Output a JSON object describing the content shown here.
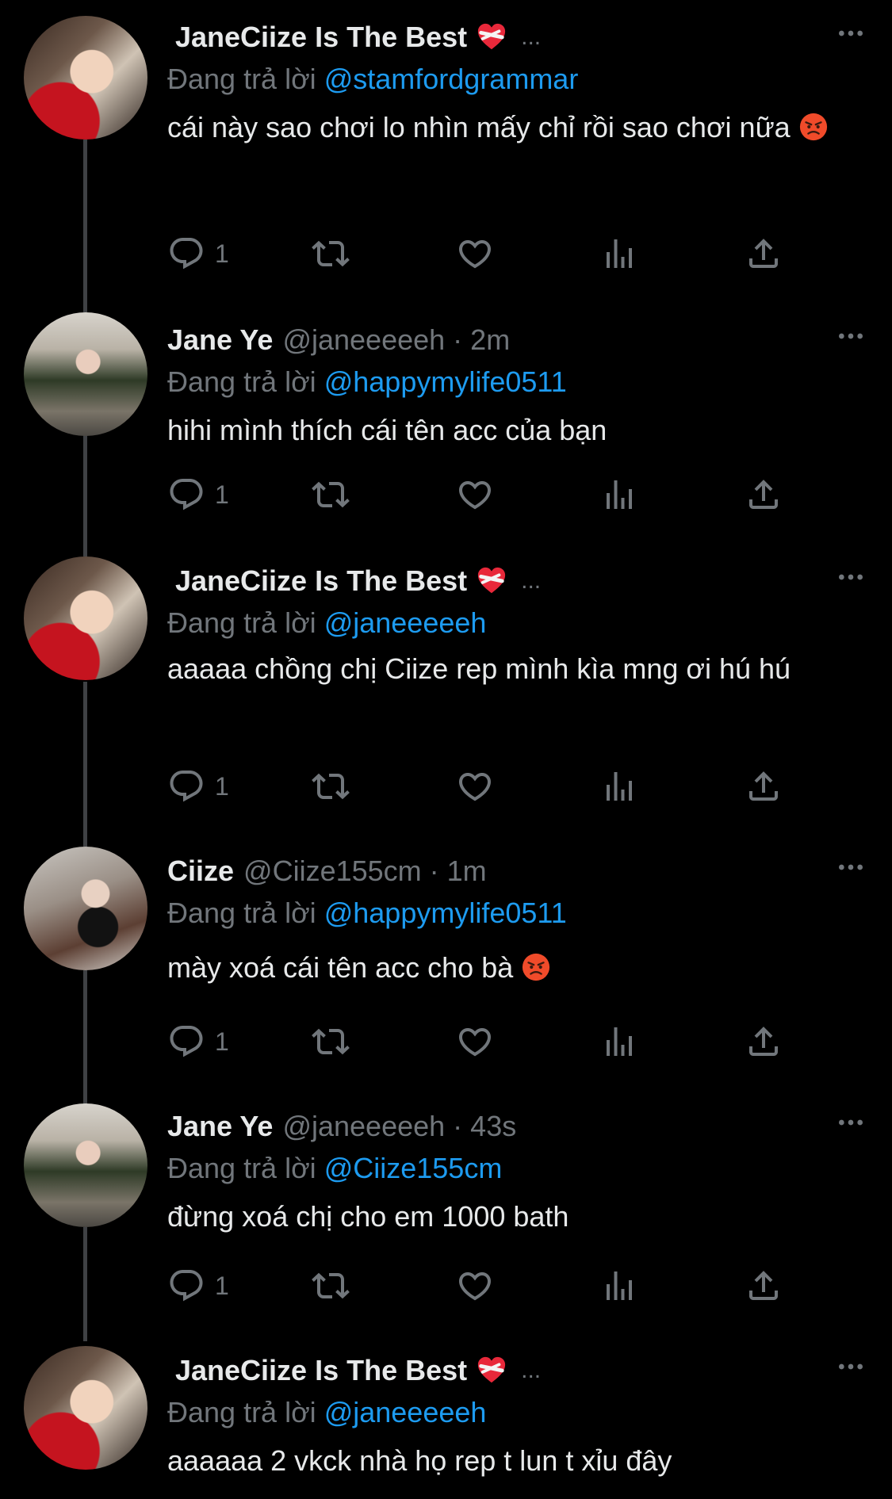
{
  "replying_prefix": "Đang trả lời",
  "colors": {
    "background": "#000000",
    "text": "#e7e9ea",
    "muted": "#71767b",
    "link": "#1d9bf0",
    "thread_line": "#3f4144"
  },
  "icons": {
    "reply": "reply-icon",
    "retweet": "retweet-icon",
    "like": "heart-icon",
    "views": "views-icon",
    "share": "share-icon",
    "more": "more-dots-icon"
  },
  "tweets": [
    {
      "name": "JaneCiize Is The Best",
      "emoji": "❤️‍🩹",
      "handle": "",
      "time": "",
      "truncated": "...",
      "replying_to": "@stamfordgrammar",
      "text": "cái này sao chơi lo nhìn mấy chỉ rồi sao chơi nữa",
      "text_emoji": "😡",
      "reply_count": "1"
    },
    {
      "name": "Jane Ye",
      "emoji": "",
      "handle": "@janeeeeeh",
      "time": "2m",
      "truncated": "",
      "replying_to": "@happymylife0511",
      "text": "hihi mình thích cái tên acc của bạn",
      "text_emoji": "",
      "reply_count": "1"
    },
    {
      "name": "JaneCiize Is The Best",
      "emoji": "❤️‍🩹",
      "handle": "",
      "time": "",
      "truncated": "...",
      "replying_to": "@janeeeeeh",
      "text": "aaaaa chồng chị Ciize rep mình kìa mng ơi hú hú",
      "text_emoji": "",
      "reply_count": "1"
    },
    {
      "name": "Ciize",
      "emoji": "",
      "handle": "@Ciize155cm",
      "time": "1m",
      "truncated": "",
      "replying_to": "@happymylife0511",
      "text": "mày xoá cái tên acc cho bà",
      "text_emoji": "😡",
      "reply_count": "1"
    },
    {
      "name": "Jane Ye",
      "emoji": "",
      "handle": "@janeeeeeh",
      "time": "43s",
      "truncated": "",
      "replying_to": "@Ciize155cm",
      "text": "đừng xoá chị cho em 1000 bath",
      "text_emoji": "",
      "reply_count": "1"
    },
    {
      "name": "JaneCiize Is The Best",
      "emoji": "❤️‍🩹",
      "handle": "",
      "time": "",
      "truncated": "...",
      "replying_to": "@janeeeeeh",
      "text": "aaaaaa 2 vkck nhà họ rep t lun t xỉu đây",
      "text_emoji": "",
      "reply_count": ""
    }
  ]
}
